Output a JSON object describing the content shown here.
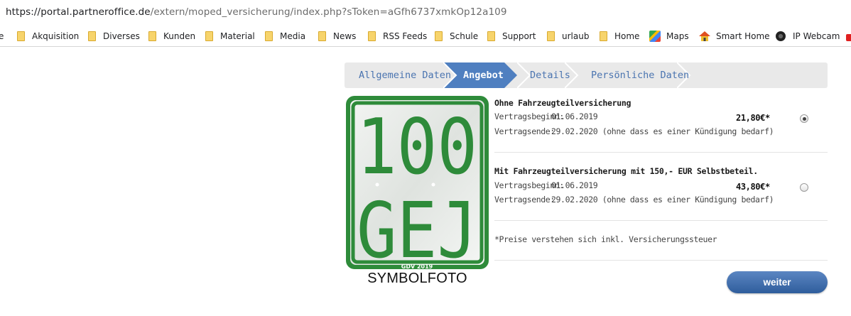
{
  "browser": {
    "url_host": "https://portal.partneroffice.de",
    "url_path": "/extern/moped_versicherung/index.php?sToken=aGfh6737xmkOp12a109",
    "bookmarks": [
      {
        "label": "e",
        "icon": "none"
      },
      {
        "label": "Akquisition",
        "icon": "folder-icon"
      },
      {
        "label": "Diverses",
        "icon": "folder-icon"
      },
      {
        "label": "Kunden",
        "icon": "folder-icon"
      },
      {
        "label": "Material",
        "icon": "folder-icon"
      },
      {
        "label": "Media",
        "icon": "folder-icon"
      },
      {
        "label": "News",
        "icon": "folder-icon"
      },
      {
        "label": "RSS Feeds",
        "icon": "folder-icon"
      },
      {
        "label": "Schule",
        "icon": "folder-icon"
      },
      {
        "label": "Support",
        "icon": "folder-icon"
      },
      {
        "label": "urlaub",
        "icon": "folder-icon"
      },
      {
        "label": "Home",
        "icon": "folder-icon"
      },
      {
        "label": "Maps",
        "icon": "maps-icon"
      },
      {
        "label": "Smart Home",
        "icon": "home-icon"
      },
      {
        "label": "IP Webcam",
        "icon": "webcam-icon"
      }
    ]
  },
  "steps": [
    {
      "label": "Allgemeine Daten",
      "active": false
    },
    {
      "label": "Angebot",
      "active": true
    },
    {
      "label": "Details",
      "active": false
    },
    {
      "label": "Persönliche Daten",
      "active": false
    }
  ],
  "symbol_photo": {
    "plate_number": "100",
    "plate_letters": "GEJ",
    "plate_small_text": "GDV 2019",
    "caption": "SYMBOLFOTO"
  },
  "offers": [
    {
      "title": "Ohne Fahrzeugteilversicherung",
      "begin_label": "Vertragsbeginn:",
      "begin_value": "01.06.2019",
      "end_label": "Vertragsende:",
      "end_value": "29.02.2020 (ohne dass es einer Kündigung bedarf)",
      "price": "21,80€*",
      "selected": true
    },
    {
      "title": "Mit Fahrzeugteilversicherung mit 150,- EUR Selbstbeteil.",
      "begin_label": "Vertragsbeginn:",
      "begin_value": "01.06.2019",
      "end_label": "Vertragsende:",
      "end_value": "29.02.2020 (ohne dass es einer Kündigung bedarf)",
      "price": "43,80€*",
      "selected": false
    }
  ],
  "footnote": "*Preise verstehen sich inkl. Versicherungssteuer",
  "next_button": "weiter",
  "colors": {
    "accent": "#4a74b0",
    "active_step": "#4f7fc0",
    "plate_green": "#2e8b3a",
    "button_top": "#5b86c2",
    "button_bottom": "#2f5d9c"
  }
}
